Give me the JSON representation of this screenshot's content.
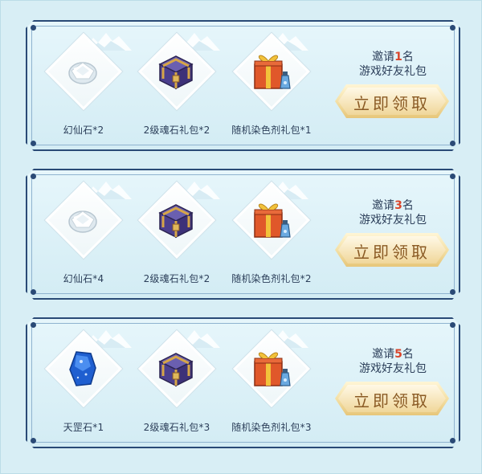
{
  "tiers": [
    {
      "invite_prefix": "邀请",
      "invite_count": "1",
      "invite_suffix": "名",
      "gift_label": "游戏好友礼包",
      "button_label": "立即领取",
      "items": [
        {
          "icon": "crystal-icon",
          "label": "幻仙石*2"
        },
        {
          "icon": "treasure-chest-icon",
          "label": "2级魂石礼包*2"
        },
        {
          "icon": "gift-box-icon",
          "label": "随机染色剂礼包*1"
        }
      ]
    },
    {
      "invite_prefix": "邀请",
      "invite_count": "3",
      "invite_suffix": "名",
      "gift_label": "游戏好友礼包",
      "button_label": "立即领取",
      "items": [
        {
          "icon": "crystal-icon",
          "label": "幻仙石*4"
        },
        {
          "icon": "treasure-chest-icon",
          "label": "2级魂石礼包*2"
        },
        {
          "icon": "gift-box-icon",
          "label": "随机染色剂礼包*2"
        }
      ]
    },
    {
      "invite_prefix": "邀请",
      "invite_count": "5",
      "invite_suffix": "名",
      "gift_label": "游戏好友礼包",
      "button_label": "立即领取",
      "items": [
        {
          "icon": "blue-gem-icon",
          "label": "天罡石*1"
        },
        {
          "icon": "treasure-chest-icon",
          "label": "2级魂石礼包*3"
        },
        {
          "icon": "gift-box-icon",
          "label": "随机染色剂礼包*3"
        }
      ]
    }
  ],
  "colors": {
    "frame": "#2a4a76",
    "highlight_number": "#d9452b",
    "button_text": "#8a5a24"
  }
}
